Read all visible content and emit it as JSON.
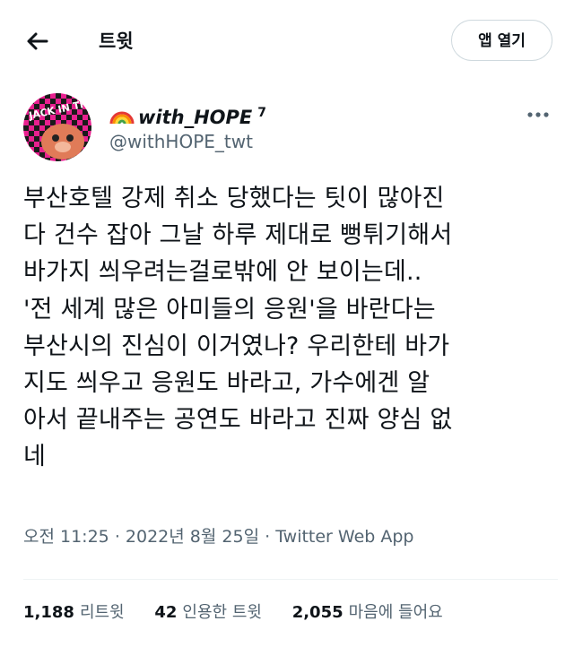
{
  "header": {
    "title": "트윗",
    "open_app_label": "앱 열기",
    "back_icon": "arrow-left-icon"
  },
  "author": {
    "emoji": "🌈",
    "name": "with_HOPE",
    "name_sup": "7",
    "handle": "@withHOPE_twt",
    "avatar_text": "JACK IN THE BOX",
    "more_icon": "more-horizontal-icon"
  },
  "tweet": {
    "text": "부산호텔 강제 취소 당했다는 팃이 많아진\n다 건수 잡아 그날 하루 제대로 뻥튀기해서\n바가지 씌우려는걸로밖에 안 보이는데..\n'전 세계 많은 아미들의 응원'을 바란다는\n부산시의 진심이 이거였나? 우리한테 바가\n지도 씌우고 응원도 바라고, 가수에겐 알\n아서 끝내주는 공연도 바라고 진짜 양심 없\n네",
    "time": "오전 11:25",
    "separator": "·",
    "date": "2022년 8월 25일",
    "source": "Twitter Web App"
  },
  "stats": {
    "retweets_count": "1,188",
    "retweets_label": "리트윗",
    "quotes_count": "42",
    "quotes_label": "인용한 트윗",
    "likes_count": "2,055",
    "likes_label": "마음에 들어요"
  },
  "colors": {
    "text": "#0f1419",
    "secondary": "#536471",
    "border": "#cfd9de",
    "avatar_pink": "#e8208f",
    "avatar_dark": "#1a1a1a"
  }
}
